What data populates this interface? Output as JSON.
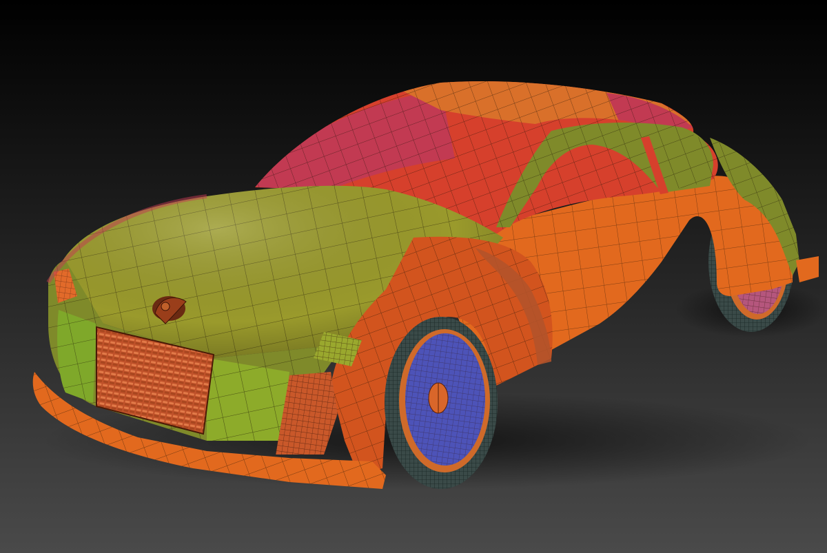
{
  "viewport": {
    "background": {
      "top": "#000000",
      "bottom": "#4a4a4a"
    }
  },
  "model": {
    "subject": "car",
    "display_mode": "polygroups-wireframe",
    "palette": {
      "yellow_green": "#9a9a2c",
      "olive": "#7f8a2a",
      "orange": "#e2691e",
      "deep_orange": "#d2541e",
      "red": "#d6402c",
      "magenta": "#c23a52",
      "rust": "#b3532a",
      "wheel_front": "#4d53b8",
      "wheel_rear": "#b5567d",
      "tire_mesh": "#3a4a48",
      "wire": "#1c1206"
    }
  }
}
